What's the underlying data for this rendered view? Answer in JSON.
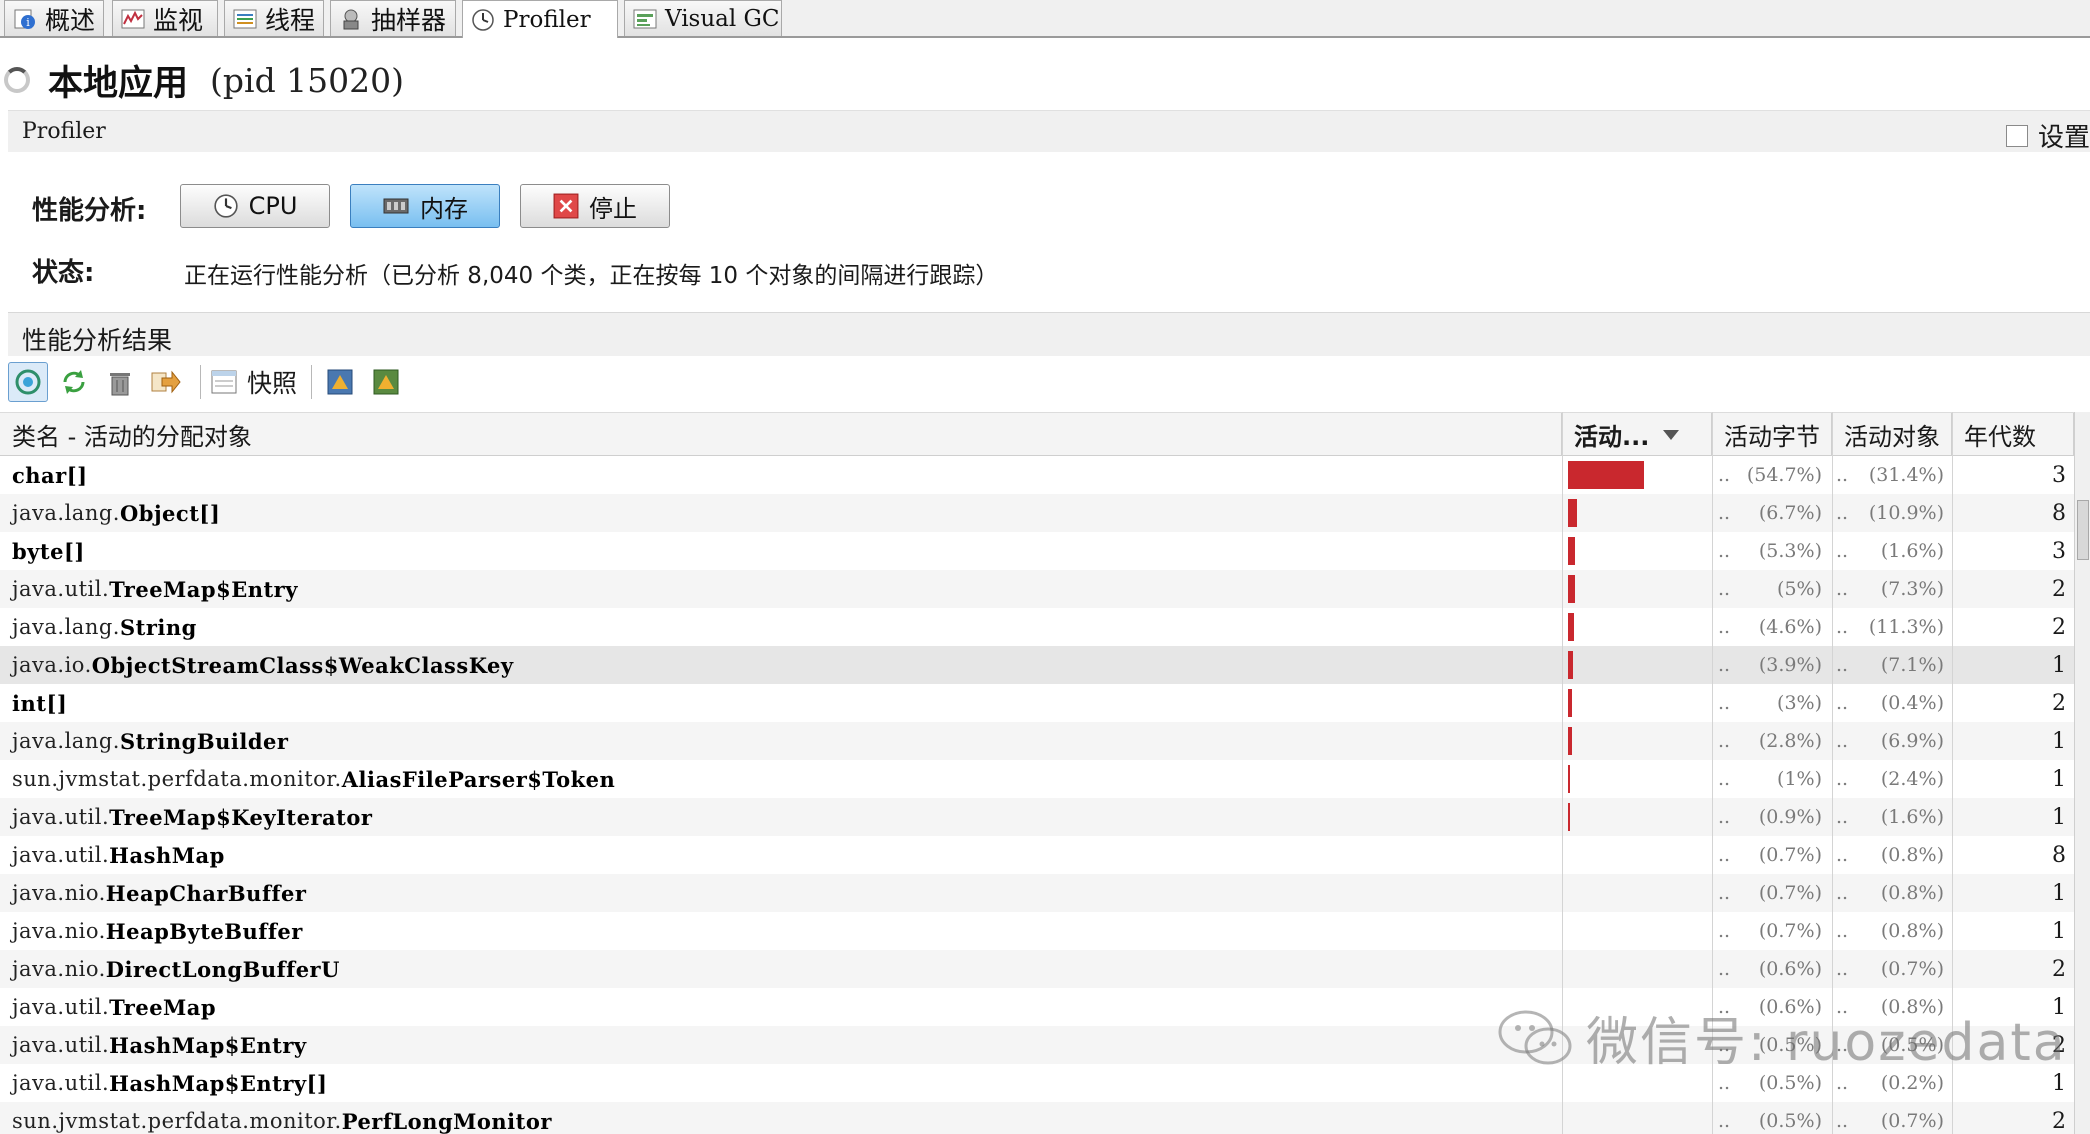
{
  "tabs": [
    {
      "label": "概述",
      "icon": "overview-icon",
      "active": false
    },
    {
      "label": "监视",
      "icon": "monitor-icon",
      "active": false
    },
    {
      "label": "线程",
      "icon": "threads-icon",
      "active": false
    },
    {
      "label": "抽样器",
      "icon": "sampler-icon",
      "active": false
    },
    {
      "label": "Profiler",
      "icon": "profiler-icon",
      "active": true
    },
    {
      "label": "Visual GC",
      "icon": "visual-gc-icon",
      "active": false
    }
  ],
  "header": {
    "app_title": "本地应用",
    "pid": "(pid 15020)"
  },
  "panel": {
    "label": "Profiler",
    "settings_label": "设置"
  },
  "controls": {
    "perf_label": "性能分析:",
    "cpu_button": "CPU",
    "memory_button": "内存",
    "stop_button": "停止",
    "status_label": "状态:",
    "status_text": "正在运行性能分析（已分析 8,040 个类，正在按每 10 个对象的间隔进行跟踪）"
  },
  "results": {
    "label": "性能分析结果",
    "snapshot_label": "快照"
  },
  "table": {
    "columns": {
      "name": "类名 - 活动的分配对象",
      "live": "活动...",
      "live_bytes": "活动字节",
      "live_objects": "活动对象",
      "generations": "年代数"
    },
    "rows": [
      {
        "pkg": "",
        "cls": "char[]",
        "bar": 54.7,
        "bytes": "(54.7%)",
        "objs": "(31.4%)",
        "gen": "3"
      },
      {
        "pkg": "java.lang.",
        "cls": "Object[]",
        "bar": 6.7,
        "bytes": "(6.7%)",
        "objs": "(10.9%)",
        "gen": "8"
      },
      {
        "pkg": "",
        "cls": "byte[]",
        "bar": 5.3,
        "bytes": "(5.3%)",
        "objs": "(1.6%)",
        "gen": "3"
      },
      {
        "pkg": "java.util.",
        "cls": "TreeMap$Entry",
        "bar": 5,
        "bytes": "(5%)",
        "objs": "(7.3%)",
        "gen": "2"
      },
      {
        "pkg": "java.lang.",
        "cls": "String",
        "bar": 4.6,
        "bytes": "(4.6%)",
        "objs": "(11.3%)",
        "gen": "2"
      },
      {
        "pkg": "java.io.",
        "cls": "ObjectStreamClass$WeakClassKey",
        "bar": 3.9,
        "bytes": "(3.9%)",
        "objs": "(7.1%)",
        "gen": "1"
      },
      {
        "pkg": "",
        "cls": "int[]",
        "bar": 3,
        "bytes": "(3%)",
        "objs": "(0.4%)",
        "gen": "2"
      },
      {
        "pkg": "java.lang.",
        "cls": "StringBuilder",
        "bar": 2.8,
        "bytes": "(2.8%)",
        "objs": "(6.9%)",
        "gen": "1"
      },
      {
        "pkg": "sun.jvmstat.perfdata.monitor.",
        "cls": "AliasFileParser$Token",
        "bar": 1,
        "bytes": "(1%)",
        "objs": "(2.4%)",
        "gen": "1"
      },
      {
        "pkg": "java.util.",
        "cls": "TreeMap$KeyIterator",
        "bar": 0.9,
        "bytes": "(0.9%)",
        "objs": "(1.6%)",
        "gen": "1"
      },
      {
        "pkg": "java.util.",
        "cls": "HashMap",
        "bar": 0,
        "bytes": "(0.7%)",
        "objs": "(0.8%)",
        "gen": "8"
      },
      {
        "pkg": "java.nio.",
        "cls": "HeapCharBuffer",
        "bar": 0,
        "bytes": "(0.7%)",
        "objs": "(0.8%)",
        "gen": "1"
      },
      {
        "pkg": "java.nio.",
        "cls": "HeapByteBuffer",
        "bar": 0,
        "bytes": "(0.7%)",
        "objs": "(0.8%)",
        "gen": "1"
      },
      {
        "pkg": "java.nio.",
        "cls": "DirectLongBufferU",
        "bar": 0,
        "bytes": "(0.6%)",
        "objs": "(0.7%)",
        "gen": "2"
      },
      {
        "pkg": "java.util.",
        "cls": "TreeMap",
        "bar": 0,
        "bytes": "(0.6%)",
        "objs": "(0.8%)",
        "gen": "1"
      },
      {
        "pkg": "java.util.",
        "cls": "HashMap$Entry",
        "bar": 0,
        "bytes": "(0.5%)",
        "objs": "(0.5%)",
        "gen": "2"
      },
      {
        "pkg": "java.util.",
        "cls": "HashMap$Entry[]",
        "bar": 0,
        "bytes": "(0.5%)",
        "objs": "(0.2%)",
        "gen": "1"
      },
      {
        "pkg": "sun.jvmstat.perfdata.monitor.",
        "cls": "PerfLongMonitor",
        "bar": 0,
        "bytes": "(0.5%)",
        "objs": "(0.7%)",
        "gen": "2"
      }
    ],
    "bar_color": "#c9282e"
  },
  "watermark": "微信号: ruozedata"
}
